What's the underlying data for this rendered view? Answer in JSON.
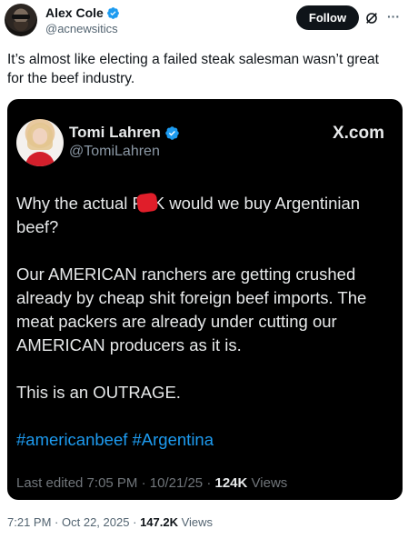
{
  "post": {
    "author_name": "Alex Cole",
    "author_handle": "@acnewsitics",
    "follow_label": "Follow",
    "more_label": "···",
    "text": "It’s almost like electing a failed steak salesman wasn’t great for the beef industry.",
    "time": "7:21 PM",
    "date": "Oct 22, 2025",
    "views_count": "147.2K",
    "views_label": "Views",
    "separator": "·"
  },
  "quoted": {
    "author_name": "Tomi Lahren",
    "author_handle": "@TomiLahren",
    "source": "X.com",
    "line1_before": "Why the actual F",
    "line1_after": "K would we buy Argentinian beef?",
    "paragraph2": "Our AMERICAN ranchers are getting crushed already by cheap shit foreign beef imports. The meat packers are already under cutting our AMERICAN producers as it is.",
    "paragraph3": "This is an OUTRAGE.",
    "hashtags": "#americanbeef #Argentina",
    "edited_label": "Last edited 7:05 PM",
    "edited_date": "10/21/25",
    "views_count": "124K",
    "views_label": "Views",
    "separator": "·"
  },
  "colors": {
    "verified": "#1d9bf0",
    "link": "#1d9bf0",
    "redaction": "#e01e2a",
    "card_bg": "#000000"
  },
  "icons": [
    "verified-badge-icon",
    "grok-icon",
    "more-icon",
    "x-logo-icon"
  ]
}
